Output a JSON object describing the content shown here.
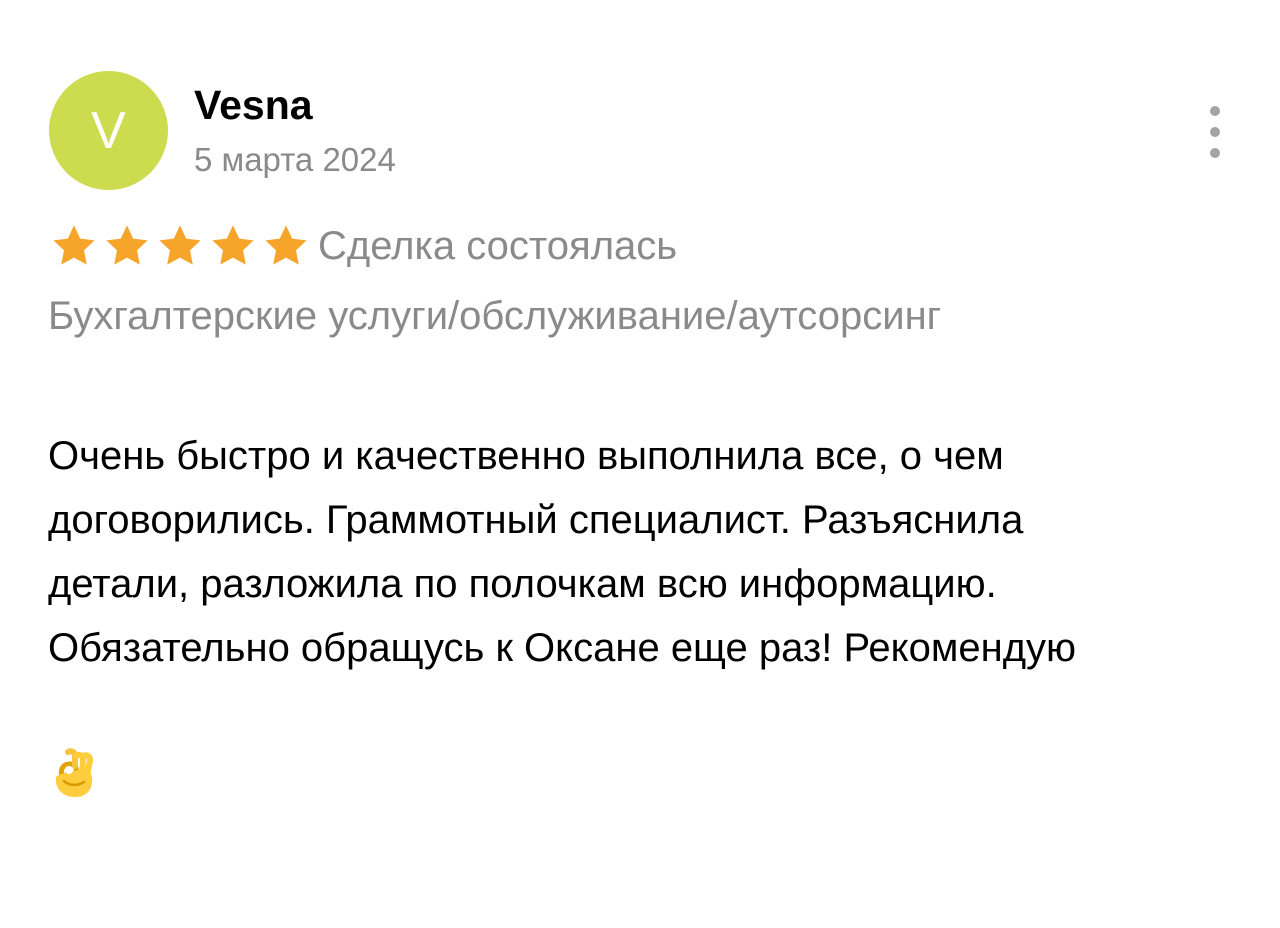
{
  "review": {
    "avatar_letter": "V",
    "author_name": "Vesna",
    "date": "5 марта 2024",
    "rating": 5,
    "rating_max": 5,
    "deal_status": "Сделка состоялась",
    "category": "Бухгалтерские услуги/обслуживание/аутсорсинг",
    "text": "Очень быстро и качественно выполнила все, о чем\nдоговорились. Граммотный специалист. Разъяснила\nдетали, разложила по полочкам всю информацию.\nОбязательно обращусь к Оксане еще раз!  Рекомендую",
    "emoji_icon": "ok-hand-icon"
  },
  "menu": {
    "icon": "more-vertical-icon"
  },
  "colors": {
    "avatar_bg": "#cddc4f",
    "star": "#f7a52a",
    "muted_text": "#8a8a8a",
    "menu_dots": "#a3a3a3"
  }
}
